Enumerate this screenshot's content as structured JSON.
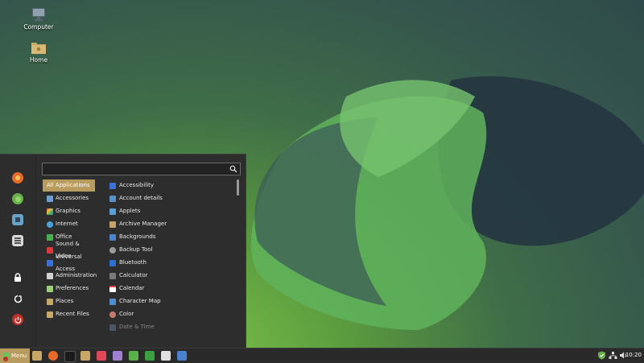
{
  "desktop": {
    "icons": [
      {
        "label": "Computer",
        "icon": "computer-icon"
      },
      {
        "label": "Home",
        "icon": "folder-icon"
      }
    ]
  },
  "menu": {
    "search": {
      "placeholder": "",
      "value": ""
    },
    "favorites": [
      "firefox-icon",
      "app-green-icon",
      "software-manager-icon",
      "settings-icon"
    ],
    "session": [
      "lock-icon",
      "logout-icon",
      "power-icon"
    ],
    "categories": [
      {
        "label": "All Applications",
        "selected": true
      },
      {
        "label": "Accessories"
      },
      {
        "label": "Graphics"
      },
      {
        "label": "Internet"
      },
      {
        "label": "Office"
      },
      {
        "label": "Sound & Video"
      },
      {
        "label": "Universal Access"
      },
      {
        "label": "Administration"
      },
      {
        "label": "Preferences"
      },
      {
        "label": "Places"
      },
      {
        "label": "Recent Files"
      }
    ],
    "apps": [
      {
        "label": "Accessibility",
        "color": "#3d6fd8"
      },
      {
        "label": "Account details",
        "color": "#5b8fc7"
      },
      {
        "label": "Applets",
        "color": "#5aa0d8"
      },
      {
        "label": "Archive Manager",
        "color": "#c9a26a"
      },
      {
        "label": "Backgrounds",
        "color": "#4a86c9"
      },
      {
        "label": "Backup Tool",
        "color": "#9a9a9a"
      },
      {
        "label": "Bluetooth",
        "color": "#2e6fd6"
      },
      {
        "label": "Calculator",
        "color": "#7a7a7a"
      },
      {
        "label": "Calendar",
        "color": "#e04848"
      },
      {
        "label": "Character Map",
        "color": "#4f8fcf"
      },
      {
        "label": "Color",
        "color": "#c87a6a"
      },
      {
        "label": "Date & Time",
        "color": "#6b8aa8"
      }
    ]
  },
  "taskbar": {
    "menu_label": "Menu",
    "clock": "10:20",
    "colors": {
      "accent": "#b89c5f",
      "panel": "#2a2a2a",
      "menu_bg": "#2d2d2d"
    }
  }
}
